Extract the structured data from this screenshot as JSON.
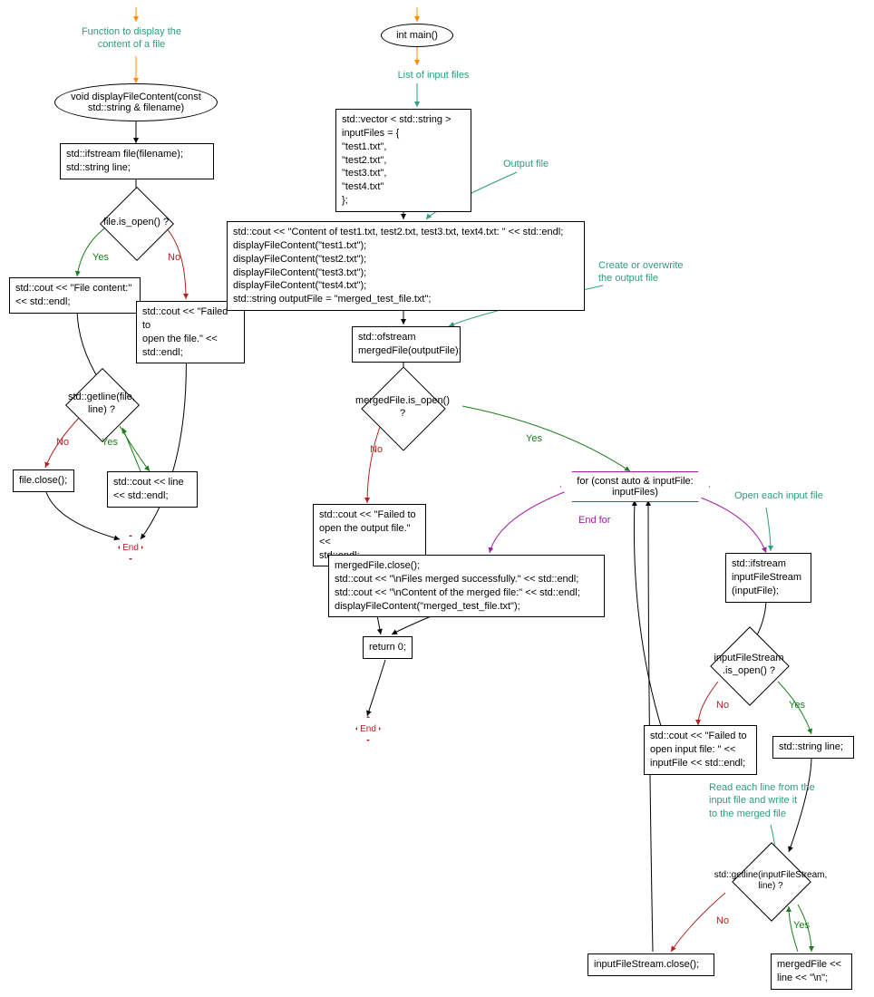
{
  "left": {
    "comment_func": "Function to display the\ncontent of a file",
    "func_sig": "void displayFileContent(const\nstd::string & filename)",
    "decl": "std::ifstream file(filename);\nstd::string line;",
    "cond_open": "file.is_open() ?",
    "print_header": "std::cout << \"File content:\"\n<< std::endl;",
    "print_fail": "std::cout << \"Failed to\nopen the file.\" <<\nstd::endl;",
    "cond_getline": "std::getline(file,\nline) ?",
    "close": "file.close();",
    "print_line": "std::cout << line\n<< std::endl;",
    "end": "End"
  },
  "right": {
    "main": "int main()",
    "comment_list": "List of input files",
    "vec": "std::vector < std::string >\ninputFiles = {\n \"test1.txt\",\n \"test2.txt\",\n \"test3.txt\",\n \"test4.txt\"\n};",
    "comment_out": "Output file",
    "block_display": "std::cout << \"Content of test1.txt, test2.txt, test3.txt, text4.txt: \" << std::endl;\ndisplayFileContent(\"test1.txt\");\ndisplayFileContent(\"test2.txt\");\ndisplayFileContent(\"test3.txt\");\ndisplayFileContent(\"test4.txt\");\nstd::string outputFile = \"merged_test_file.txt\";",
    "comment_create": "Create or overwrite\nthe output file",
    "ofstream": "std::ofstream\nmergedFile(outputFile);",
    "cond_merged_open": "mergedFile.is_open() ?",
    "fail_out": "std::cout << \"Failed to\nopen the output file.\" <<\nstd::endl;",
    "forloop": "for (const auto & inputFile:\ninputFiles)",
    "comment_openeach": "Open each input file",
    "ifstream": "std::ifstream\ninputFileStream\n(inputFile);",
    "after_merge": "mergedFile.close();\nstd::cout << \"\\nFiles merged successfully.\" << std::endl;\nstd::cout << \"\\nContent of the merged file:\" << std::endl;\ndisplayFileContent(\"merged_test_file.txt\");",
    "cond_instream_open": "inputFileStream\n.is_open() ?",
    "fail_in": "std::cout << \"Failed to\nopen input file: \" <<\ninputFile << std::endl;",
    "decl_line": "std::string line;",
    "comment_readeach": "Read each line from the\ninput file and write it\nto the merged file",
    "cond_getline2": "std::getline(inputFileStream,\nline) ?",
    "close_in": "inputFileStream.close();",
    "write_line": "mergedFile <<\nline << \"\\n\";",
    "return0": "return 0;",
    "end": "End"
  },
  "labels": {
    "yes": "Yes",
    "no": "No",
    "endfor": "End for"
  }
}
